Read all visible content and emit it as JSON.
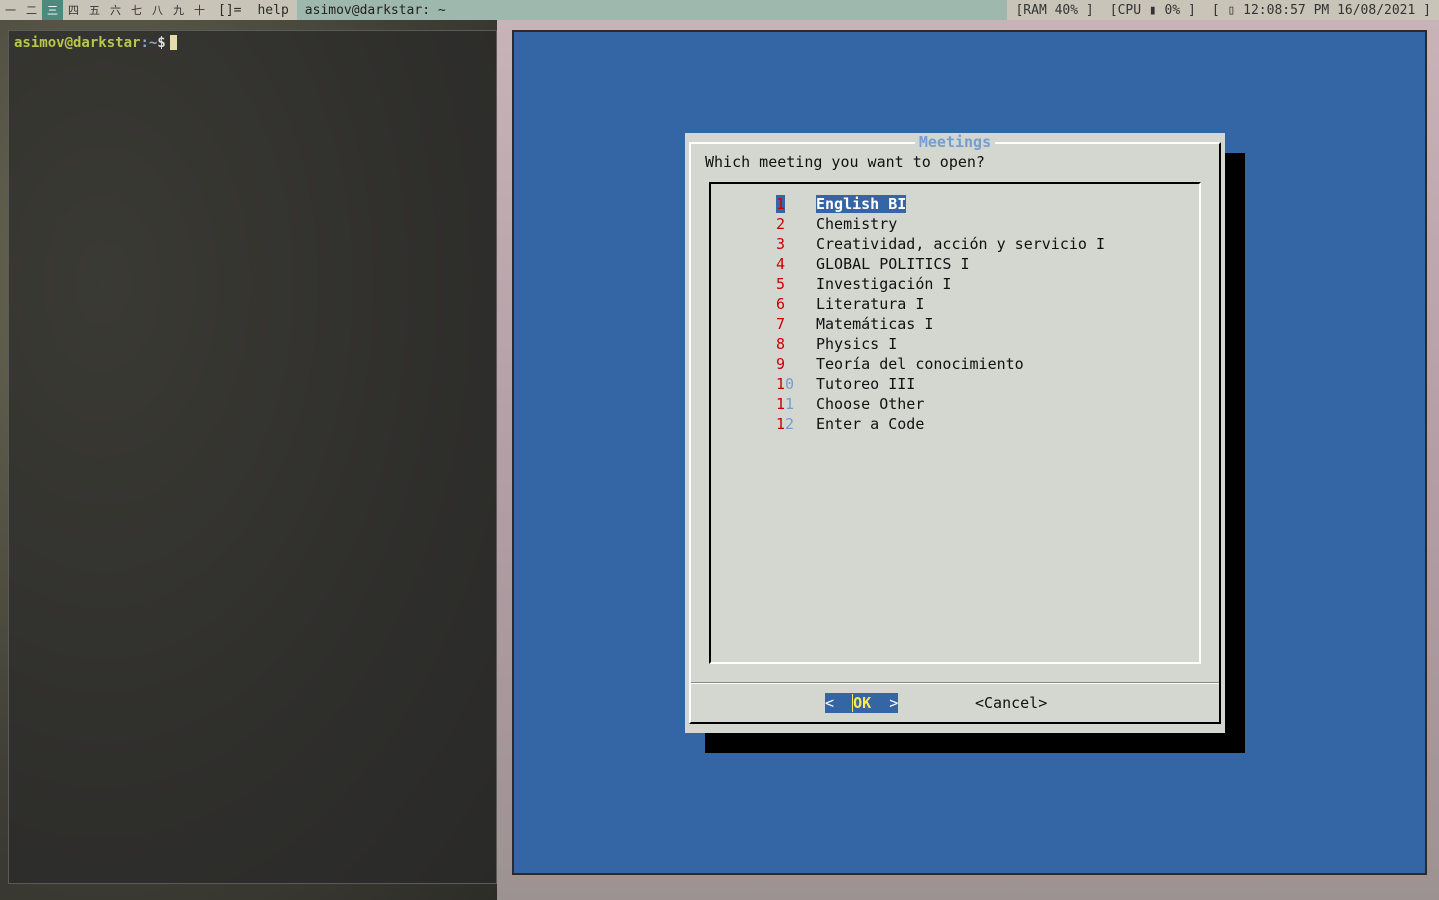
{
  "topbar": {
    "workspaces": [
      "一",
      "二",
      "三",
      "四",
      "五",
      "六",
      "七",
      "八",
      "九",
      "十"
    ],
    "active_workspace": 2,
    "layout_symbol": "[]=",
    "tag": "help",
    "window_title": "asimov@darkstar: ~",
    "ram": "[RAM 40% ]",
    "cpu": "[CPU ▮ 0% ]",
    "clock": "[ ▯ 12:08:57 PM 16/08/2021 ]"
  },
  "terminal": {
    "user_host": "asimov@darkstar",
    "cwd": ":~",
    "symbol": "$"
  },
  "dialog": {
    "title": "Meetings",
    "question": "Which meeting you want to open?",
    "items": [
      {
        "num": "1",
        "label": "English BI"
      },
      {
        "num": "2",
        "label": "Chemistry"
      },
      {
        "num": "3",
        "label": "Creatividad, acción y servicio I"
      },
      {
        "num": "4",
        "label": "GLOBAL POLITICS I"
      },
      {
        "num": "5",
        "label": "Investigación I"
      },
      {
        "num": "6",
        "label": "Literatura I"
      },
      {
        "num": "7",
        "label": "Matemáticas I"
      },
      {
        "num": "8",
        "label": "Physics I"
      },
      {
        "num": "9",
        "label": "Teoría del conocimiento"
      },
      {
        "num": "10",
        "label": "Tutoreo III"
      },
      {
        "num": "11",
        "label": "Choose Other"
      },
      {
        "num": "12",
        "label": "Enter a Code"
      }
    ],
    "selected_index": 0,
    "ok_label": "OK",
    "cancel_label": "Cancel",
    "colors": {
      "background": "#3465a4",
      "dialog": "#d3d7cf",
      "hotkey": "#cc0000",
      "title": "#729fcf"
    }
  }
}
